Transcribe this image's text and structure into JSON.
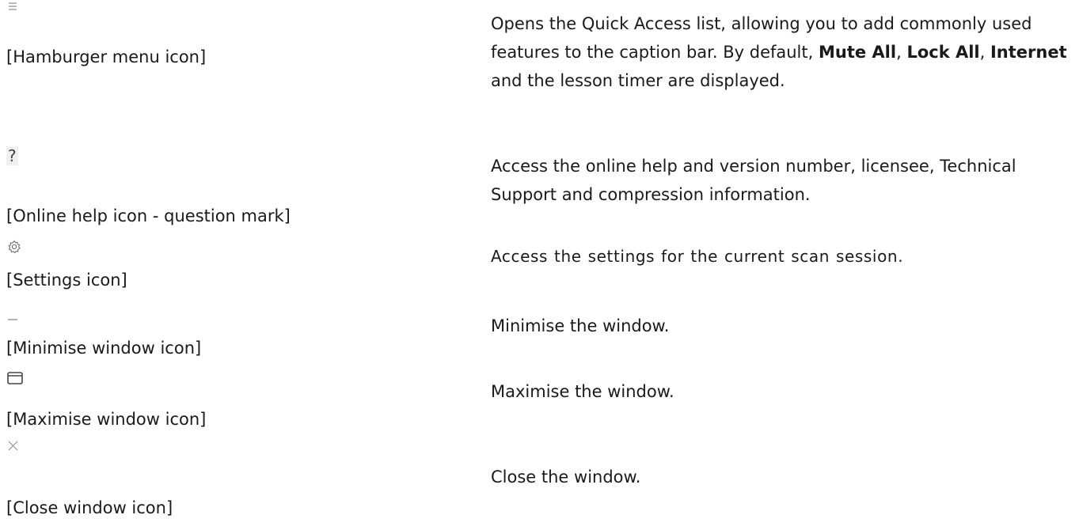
{
  "rows": [
    {
      "icon": "hamburger-menu-icon",
      "caption": "[Hamburger menu icon]",
      "desc_pre": "Opens the Quick Access list, allowing you to add commonly used features to the caption bar. By default, ",
      "bold1": "Mute All",
      "sep1": ", ",
      "bold2": "Lock All",
      "sep2": ", ",
      "bold3": "Internet",
      "desc_post": " and the lesson timer are displayed."
    },
    {
      "icon": "help-icon",
      "glyph": "?",
      "caption": "[Online help icon - question mark]",
      "desc": "Access the online help and version number, licensee, Technical Support and compression information."
    },
    {
      "icon": "gear-icon",
      "caption": "[Settings icon]",
      "desc": "Access the settings for the current scan session."
    },
    {
      "icon": "minimise-icon",
      "caption": "[Minimise window icon]",
      "desc": "Minimise the window."
    },
    {
      "icon": "maximise-icon",
      "caption": "[Maximise window icon]",
      "desc": "Maximise the window."
    },
    {
      "icon": "close-icon",
      "caption": "[Close window icon]",
      "desc": "Close the window."
    }
  ]
}
